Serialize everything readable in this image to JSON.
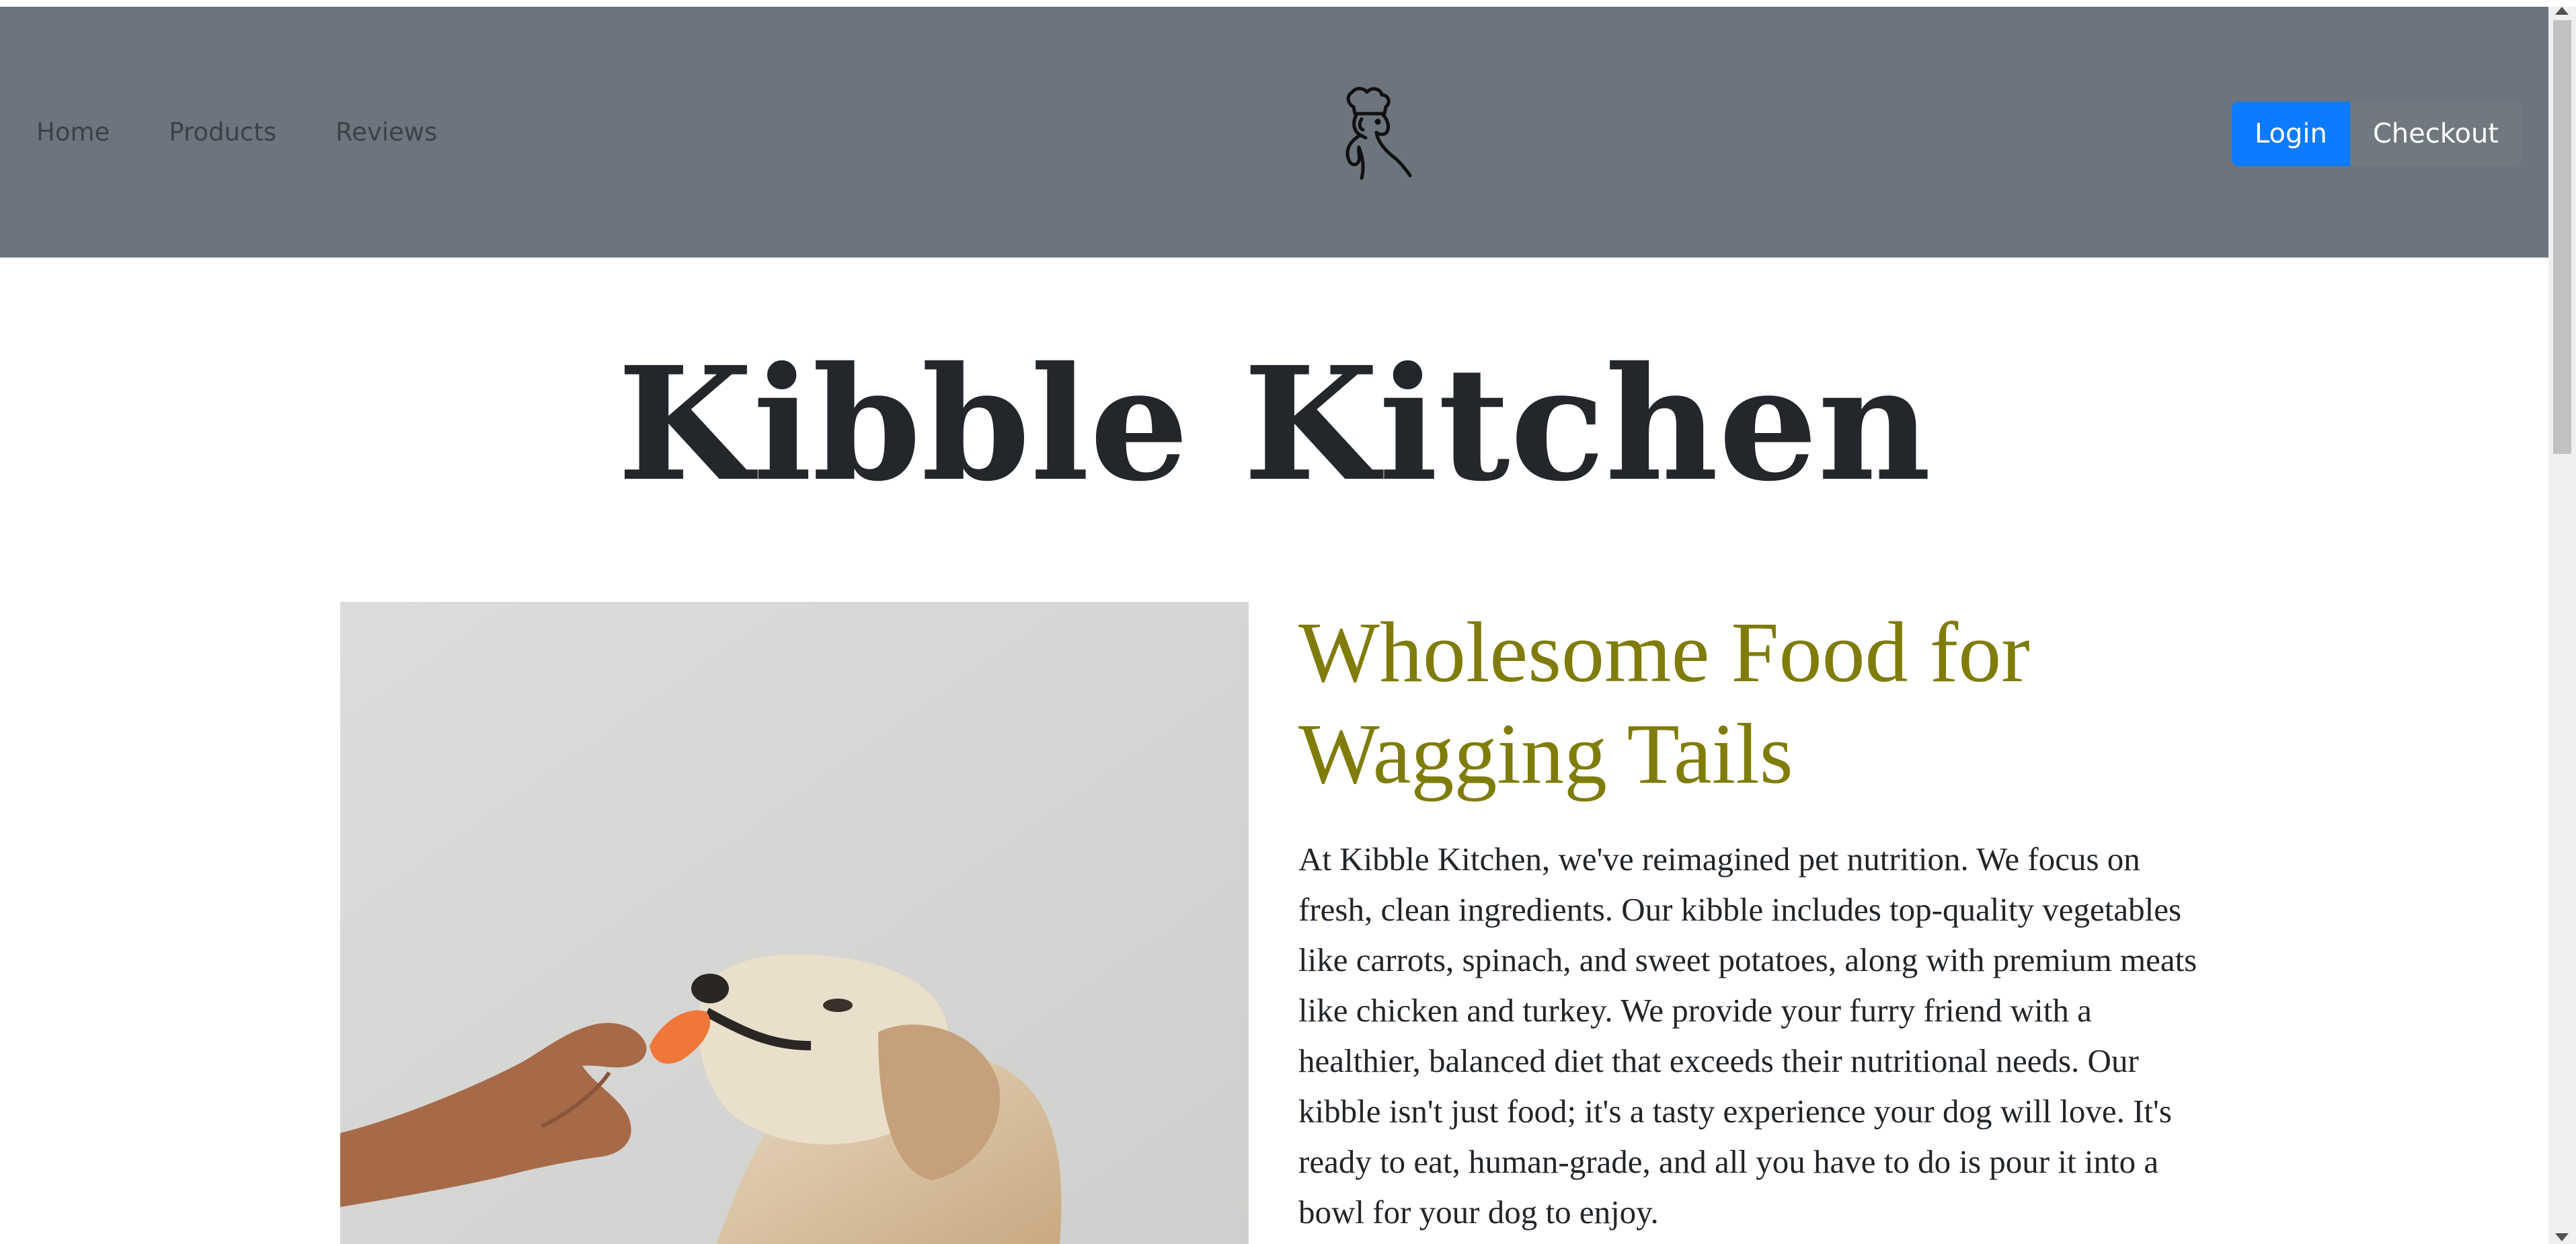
{
  "nav": {
    "links": [
      "Home",
      "Products",
      "Reviews"
    ],
    "login_label": "Login",
    "checkout_label": "Checkout",
    "logo_icon": "chef-dog-logo-icon"
  },
  "hero": {
    "title": "Kibble Kitchen"
  },
  "main": {
    "subtitle": "Wholesome Food for Wagging Tails",
    "paragraph": "At Kibble Kitchen, we've reimagined pet nutrition. We focus on fresh, clean ingredients. Our kibble includes top-quality vegetables like carrots, spinach, and sweet potatoes, along with premium meats like chicken and turkey. We provide your furry friend with a healthier, balanced diet that exceeds their nutritional needs. Our kibble isn't just food; it's a tasty experience your dog will love. It's ready to eat, human-grade, and all you have to do is pour it into a bowl for your dog to enjoy.",
    "image_icon": "dog-eating-carrot-photo"
  },
  "colors": {
    "navbar_bg": "#6c757d",
    "login_bg": "#0d7bff",
    "subtitle": "#7f7c0a",
    "title": "#23272b"
  }
}
